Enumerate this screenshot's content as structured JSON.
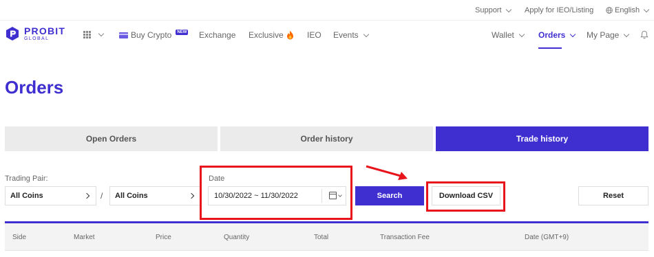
{
  "topbar": {
    "support": "Support",
    "apply_ieo": "Apply for IEO/Listing",
    "language": "English"
  },
  "brand": {
    "name": "PROBIT",
    "sub": "GLOBAL",
    "color": "#3f2fd1"
  },
  "nav": {
    "buy_crypto": "Buy Crypto",
    "new_badge": "NEW",
    "exchange": "Exchange",
    "exclusive": "Exclusive",
    "ieo": "IEO",
    "events": "Events",
    "wallet": "Wallet",
    "orders": "Orders",
    "my_page": "My Page"
  },
  "page_title": "Orders",
  "tabs": [
    {
      "label": "Open Orders",
      "active": false
    },
    {
      "label": "Order history",
      "active": false
    },
    {
      "label": "Trade history",
      "active": true
    }
  ],
  "filters": {
    "trading_pair_label": "Trading Pair:",
    "base_coin": "All Coins",
    "separator": "/",
    "quote_coin": "All Coins",
    "date_label": "Date",
    "date_range": "10/30/2022 ~ 11/30/2022",
    "search_label": "Search",
    "download_csv_label": "Download CSV",
    "reset_label": "Reset"
  },
  "table": {
    "columns": [
      "Side",
      "Market",
      "Price",
      "Quantity",
      "Total",
      "Transaction Fee",
      "Date (GMT+9)"
    ]
  },
  "colors": {
    "accent": "#3f2fd1",
    "annotation_red": "#e8141b",
    "tab_inactive": "#ebebeb"
  }
}
